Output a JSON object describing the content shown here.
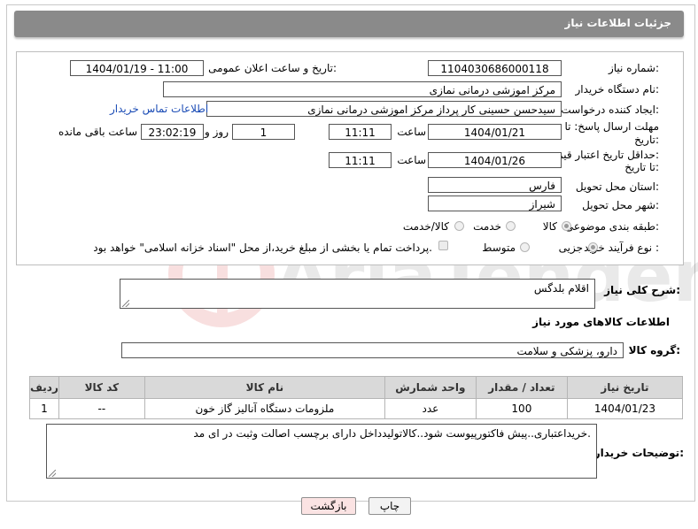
{
  "header": {
    "title": "جزئیات اطلاعات نیاز"
  },
  "fields": {
    "need_number_label": "شماره نیاز:",
    "need_number": "1104030686000118",
    "announce_label": "تاریخ و ساعت اعلان عمومی:",
    "announce_value": "1404/01/19 - 11:00",
    "buyer_org_label": "نام دستگاه خریدار:",
    "buyer_org": "مرکز اموزشی درمانی نمازی",
    "requester_label": "ایجاد کننده درخواست:",
    "requester": "سیدحسن حسینی کار پرداز مرکز اموزشی درمانی نمازی",
    "contact_link": "اطلاعات تماس خریدار",
    "reply_deadline_label_1": "مهلت ارسال پاسخ: تا",
    "reply_deadline_label_2": "تاریخ:",
    "reply_date": "1404/01/21",
    "time_label": "ساعت",
    "reply_time": "11:11",
    "days_value": "1",
    "days_label": "روز و",
    "remaining_time": "23:02:19",
    "remaining_label": "ساعت باقی مانده",
    "price_deadline_label_1": "حداقل تاریخ اعتبار قیمت:",
    "price_deadline_label_2": "تا تاریخ:",
    "price_date": "1404/01/26",
    "price_time": "11:11",
    "province_label": "استان محل تحویل:",
    "province": "فارس",
    "city_label": "شهر محل تحویل:",
    "city": "شیراز",
    "category_label": "طبقه بندی موضوعی:",
    "category_goods": "کالا",
    "category_service": "خدمت",
    "category_both": "کالا/خدمت",
    "process_label": "نوع فرآیند خرید :",
    "process_partial": "جزیی",
    "process_medium": "متوسط",
    "payment_note": "پرداخت تمام یا بخشی از مبلغ خرید،از محل \"اسناد خزانه اسلامی\" خواهد بود."
  },
  "description": {
    "label": "شرح کلی نیاز:",
    "value": "اقلام بلدگس"
  },
  "goods_info": {
    "title": "اطلاعات کالاهای مورد نیاز",
    "group_label": "گروه کالا:",
    "group_value": "دارو، پزشکی و سلامت"
  },
  "table": {
    "headers": [
      "ردیف",
      "کد کالا",
      "نام کالا",
      "واحد شمارش",
      "تعداد / مقدار",
      "تاریخ نیاز"
    ],
    "rows": [
      [
        "1",
        "--",
        "ملزومات دستگاه آنالیز گاز خون",
        "عدد",
        "100",
        "1404/01/23"
      ]
    ]
  },
  "buyer_notes": {
    "label": "توضیحات خریدار:",
    "value": "خریداعتباری..پیش فاکتورپیوست شود..کالاتولیدداخل دارای برچسب اصالت وثبت در ای مد."
  },
  "buttons": {
    "print": "چاپ",
    "back": "بازگشت"
  },
  "watermark": {
    "text": "AriaTender.neT"
  },
  "colors": {
    "header": "#8a8a8a",
    "link": "#1a4bb5",
    "back_button": "#fbe3e3"
  }
}
